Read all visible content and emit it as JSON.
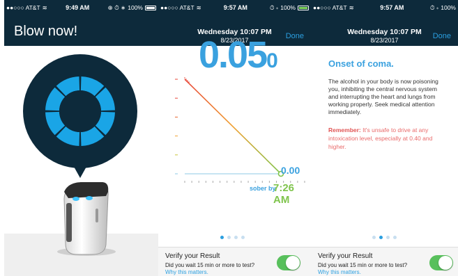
{
  "screen1": {
    "status": {
      "carrier": "●●○○○ AT&T",
      "time": "9:49 AM",
      "icons": "⊕ ⏱ ∗",
      "battery": "100%"
    },
    "title": "Blow now!",
    "icons": {
      "ring": "breath-ring-icon",
      "device": "breathalyzer-device"
    }
  },
  "screen2": {
    "status": {
      "carrier": "●●○○○ AT&T",
      "time": "9:57 AM",
      "icons": "⏱ ∗",
      "battery": "100%"
    },
    "nav": {
      "title": "Wednesday 10:07 PM",
      "subtitle": "8/23/2017",
      "done": "Done"
    },
    "bac_value": "0.05",
    "bac_suffix": "0",
    "end_value": "0.00",
    "sober_label": "sober by",
    "sober_time": "7:26 AM",
    "page_dots": 4,
    "active_dot": 0,
    "verify": {
      "title": "Verify your Result",
      "question": "Did you wait 15 min or more to test?",
      "link": "Why this matters.",
      "toggle_on": true
    },
    "chart_data": {
      "type": "line",
      "x": [
        "10:07 PM",
        "7:26 AM"
      ],
      "series": [
        {
          "values": [
            0.05,
            0.0
          ]
        }
      ],
      "colors": {
        "start": "#e8483b",
        "end": "#7fc44c",
        "baseline": "#8ecae6"
      }
    }
  },
  "screen3": {
    "status": {
      "carrier": "●●○○○ AT&T",
      "time": "9:57 AM",
      "icons": "⏱ ∗",
      "battery": "100%"
    },
    "nav": {
      "title": "Wednesday 10:07 PM",
      "subtitle": "8/23/2017",
      "done": "Done"
    },
    "heading": "Onset of coma.",
    "body": "The alcohol in your body is now poisoning you, inhibiting the central nervous system and interrupting the heart and lungs from working properly. Seek medical attention immediately.",
    "remember_label": "Remember:",
    "remember_text": " It's unsafe to drive at any intoxication level, especially at 0.40 and higher.",
    "page_dots": 4,
    "active_dot": 1,
    "verify": {
      "title": "Verify your Result",
      "question": "Did you wait 15 min or more to test?",
      "link": "Why this matters.",
      "toggle_on": true
    }
  },
  "colors": {
    "navbar": "#0d2a3b",
    "accent": "#3aa1df",
    "toggle": "#58c05c",
    "warning": "#e15454"
  }
}
